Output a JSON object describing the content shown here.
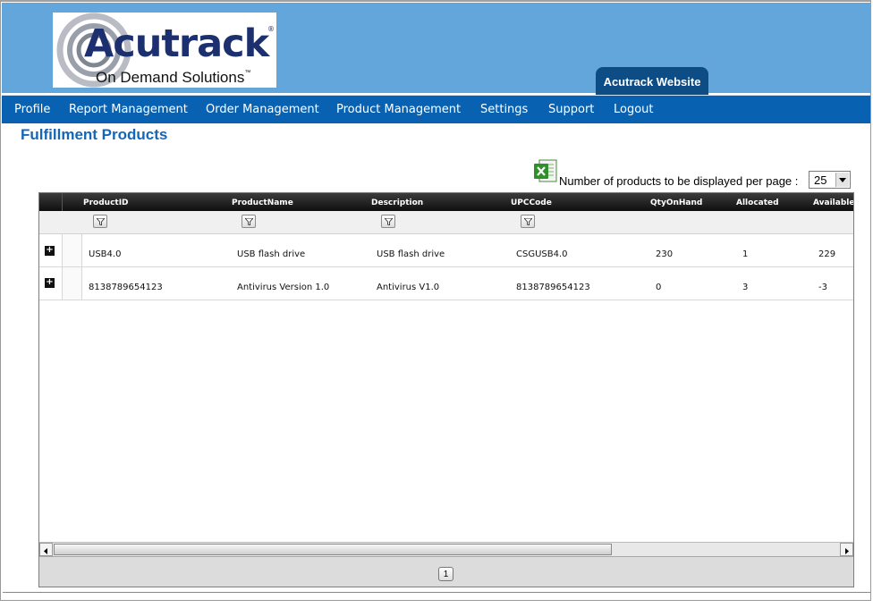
{
  "header": {
    "logo_main": "Acutrack",
    "logo_reg": "®",
    "logo_sub": "On Demand Solutions",
    "logo_tm": "™",
    "site_link": "Acutrack Website"
  },
  "nav": {
    "items": [
      "Profile",
      "Report Management",
      "Order Management",
      "Product Management",
      "Settings",
      "Support",
      "Logout"
    ]
  },
  "page": {
    "title": "Fulfillment Products",
    "per_page_label": "Number of products to be displayed per page :",
    "per_page_value": "25"
  },
  "grid": {
    "columns": [
      "ProductID",
      "ProductName",
      "Description",
      "UPCCode",
      "QtyOnHand",
      "Allocated",
      "Available"
    ],
    "rows": [
      [
        "USB4.0",
        "USB flash drive",
        "USB flash drive",
        "CSGUSB4.0",
        "230",
        "1",
        "229"
      ],
      [
        "8138789654123",
        "Antivirus Version 1.0",
        "Antivirus V1.0",
        "8138789654123",
        "0",
        "3",
        "-3"
      ]
    ],
    "expand_glyph": "+",
    "pager": {
      "pages": [
        "1"
      ],
      "current": "1"
    }
  },
  "colors": {
    "header_bg": "#62a6dc",
    "nav_bg": "#0862b1",
    "title": "#1466b8",
    "site_tab": "#0d4c84"
  },
  "icons": [
    "excel-export-icon",
    "filter-icon",
    "expand-icon",
    "scroll-left-icon",
    "scroll-right-icon",
    "dropdown-arrow-icon"
  ]
}
